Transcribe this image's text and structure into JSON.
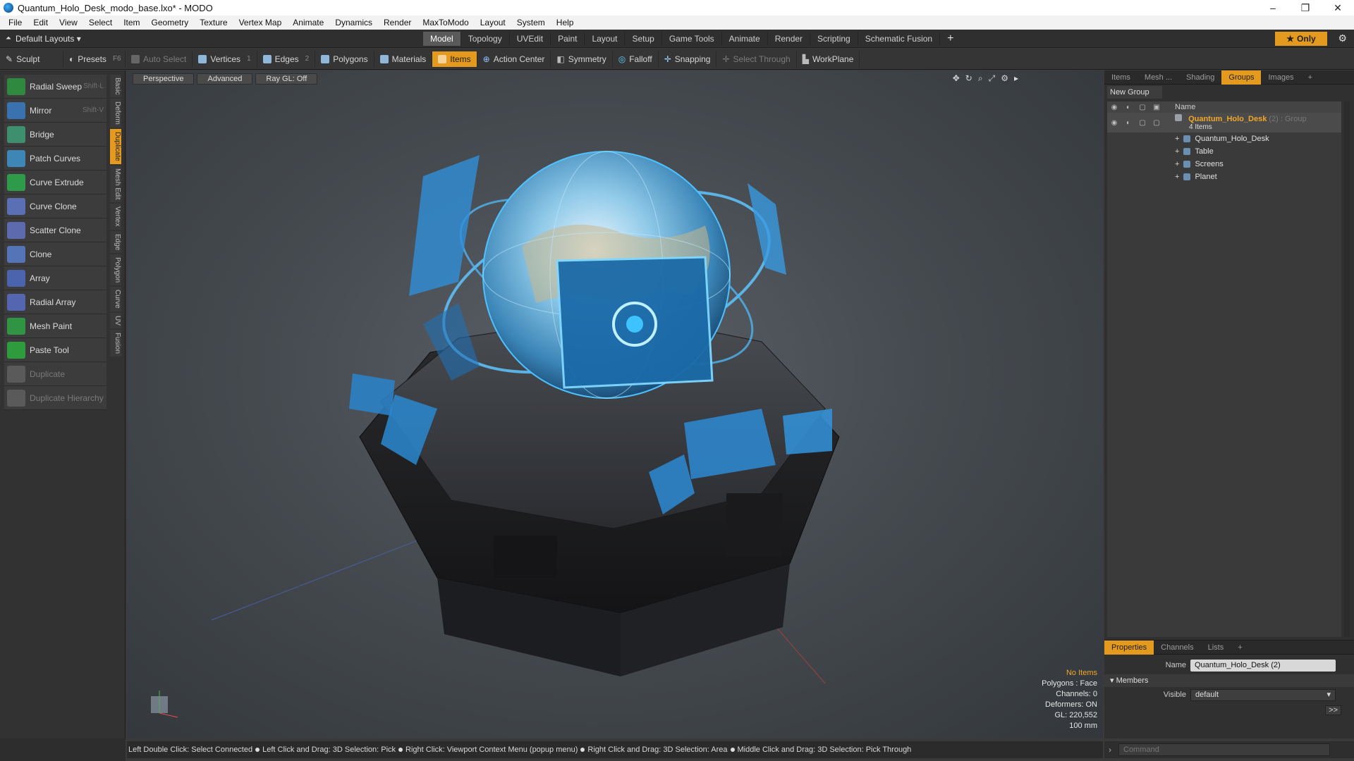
{
  "window": {
    "title": "Quantum_Holo_Desk_modo_base.lxo* - MODO",
    "controls": [
      "–",
      "❐",
      "✕"
    ]
  },
  "menu": [
    "File",
    "Edit",
    "View",
    "Select",
    "Item",
    "Geometry",
    "Texture",
    "Vertex Map",
    "Animate",
    "Dynamics",
    "Render",
    "MaxToModo",
    "Layout",
    "System",
    "Help"
  ],
  "layout_bar": {
    "layout_label": "Default Layouts ▾",
    "tabs": [
      "Model",
      "Topology",
      "UVEdit",
      "Paint",
      "Layout",
      "Setup",
      "Game Tools",
      "Animate",
      "Render",
      "Scripting",
      "Schematic Fusion"
    ],
    "active_tab": "Model",
    "plus": "+",
    "only_label": "Only"
  },
  "toolbar": {
    "sculpt": "Sculpt",
    "presets": "Presets",
    "presets_key": "F6",
    "auto_select": "Auto Select",
    "vertices": "Vertices",
    "vertices_count": "1",
    "edges": "Edges",
    "edges_count": "2",
    "polygons": "Polygons",
    "materials": "Materials",
    "items": "Items",
    "action_center": "Action Center",
    "symmetry": "Symmetry",
    "falloff": "Falloff",
    "snapping": "Snapping",
    "select_through": "Select Through",
    "workplane": "WorkPlane"
  },
  "tools": [
    {
      "label": "Radial Sweep",
      "shortcut": "Shift-L",
      "color": "#2f8a3f",
      "disabled": false
    },
    {
      "label": "Mirror",
      "shortcut": "Shift-V",
      "color": "#3a72b0",
      "disabled": false
    },
    {
      "label": "Bridge",
      "shortcut": "",
      "color": "#3d8f6e",
      "disabled": false
    },
    {
      "label": "Patch Curves",
      "shortcut": "",
      "color": "#3e86b5",
      "disabled": false
    },
    {
      "label": "Curve Extrude",
      "shortcut": "",
      "color": "#2f9a4a",
      "disabled": false
    },
    {
      "label": "Curve Clone",
      "shortcut": "",
      "color": "#5b6fb5",
      "disabled": false
    },
    {
      "label": "Scatter Clone",
      "shortcut": "",
      "color": "#5d6aae",
      "disabled": false
    },
    {
      "label": "Clone",
      "shortcut": "",
      "color": "#5574b8",
      "disabled": false
    },
    {
      "label": "Array",
      "shortcut": "",
      "color": "#4c63ad",
      "disabled": false
    },
    {
      "label": "Radial Array",
      "shortcut": "",
      "color": "#5566b0",
      "disabled": false
    },
    {
      "label": "Mesh Paint",
      "shortcut": "",
      "color": "#2f9444",
      "disabled": false
    },
    {
      "label": "Paste Tool",
      "shortcut": "",
      "color": "#2e9c3c",
      "disabled": false
    },
    {
      "label": "Duplicate",
      "shortcut": "",
      "color": "#5a5a5a",
      "disabled": true
    },
    {
      "label": "Duplicate Hierarchy",
      "shortcut": "",
      "color": "#5a5a5a",
      "disabled": true
    }
  ],
  "side_tabs": [
    "Basic",
    "Deform",
    "Duplicate",
    "Mesh Edit",
    "Vertex",
    "Edge",
    "Polygon",
    "Curve",
    "UV",
    "Fusion"
  ],
  "active_side_tab": "Duplicate",
  "viewport": {
    "view": "Perspective",
    "mode": "Advanced",
    "raygl": "Ray GL: Off",
    "info": {
      "no_items": "No Items",
      "polygons": "Polygons : Face",
      "channels": "Channels: 0",
      "deformers": "Deformers: ON",
      "gl": "GL: 220,552",
      "scale": "100 mm"
    }
  },
  "right_panel": {
    "tabs": [
      "Items",
      "Mesh ...",
      "Shading",
      "Groups",
      "Images",
      "+"
    ],
    "active_tab": "Groups",
    "new_group": "New Group",
    "name_header": "Name",
    "group": {
      "name": "Quantum_Holo_Desk",
      "suffix": "(2) : Group",
      "count": "4 Items",
      "children": [
        "Quantum_Holo_Desk",
        "Table",
        "Screens",
        "Planet"
      ]
    }
  },
  "properties": {
    "tabs": [
      "Properties",
      "Channels",
      "Lists",
      "+"
    ],
    "active_tab": "Properties",
    "name_label": "Name",
    "name_value": "Quantum_Holo_Desk (2)",
    "members": "Members",
    "visible_label": "Visible",
    "visible_value": "default",
    "more": ">>"
  },
  "command_placeholder": "Command",
  "status": [
    "Left Double Click: Select Connected",
    "Left Click and Drag: 3D Selection: Pick",
    "Right Click: Viewport Context Menu (popup menu)",
    "Right Click and Drag: 3D Selection: Area",
    "Middle Click and Drag: 3D Selection: Pick Through"
  ],
  "colors": {
    "accent": "#e39a1f",
    "holo": "#3fb4ff",
    "group_label": "#f0a62a"
  }
}
